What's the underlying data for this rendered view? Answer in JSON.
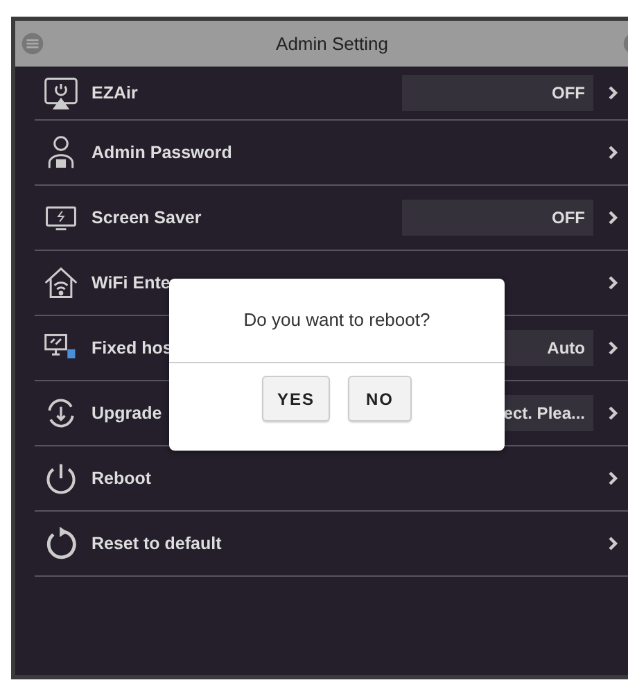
{
  "header": {
    "title": "Admin Setting"
  },
  "rows": [
    {
      "label": "EZAir",
      "value": "OFF"
    },
    {
      "label": "Admin Password"
    },
    {
      "label": "Screen Saver",
      "value": "OFF"
    },
    {
      "label": "WiFi Ente"
    },
    {
      "label": "Fixed hos",
      "value": "Auto"
    },
    {
      "label": "Upgrade",
      "value": "ect. Plea..."
    },
    {
      "label": "Reboot"
    },
    {
      "label": "Reset to default"
    }
  ],
  "dialog": {
    "message": "Do you want to reboot?",
    "buttons": [
      "YES",
      "NO"
    ]
  }
}
